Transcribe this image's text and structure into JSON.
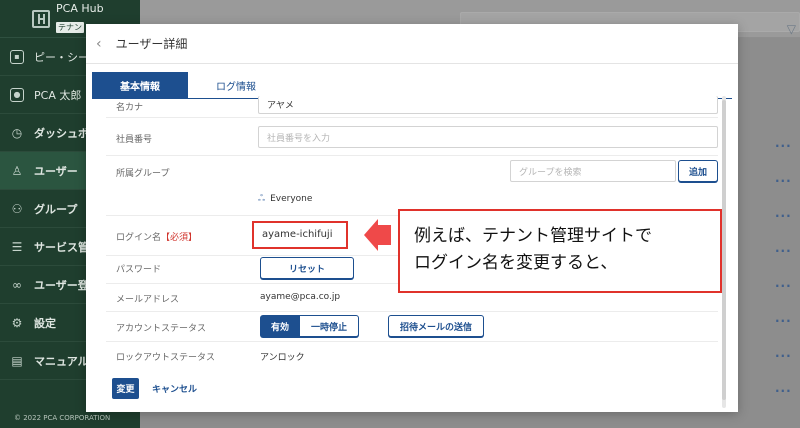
{
  "sidebar": {
    "logo_text": "PCA Hub",
    "logo_sub": "テナン",
    "items": [
      {
        "label": "ピー・シー",
        "icon": "building-icon"
      },
      {
        "label": "PCA 太郎",
        "icon": "user-avatar-icon"
      },
      {
        "label": "ダッシュボ",
        "icon": "clock-icon"
      },
      {
        "label": "ユーザー",
        "icon": "person-icon"
      },
      {
        "label": "グループ",
        "icon": "group-icon"
      },
      {
        "label": "サービス管",
        "icon": "server-icon"
      },
      {
        "label": "ユーザー登",
        "icon": "link-icon"
      },
      {
        "label": "設定",
        "icon": "gear-icon"
      },
      {
        "label": "マニュアル",
        "icon": "book-icon"
      }
    ],
    "copyright": "© 2022 PCA CORPORATION"
  },
  "modal": {
    "title": "ユーザー詳細",
    "tabs": [
      "基本情報",
      "ログ情報"
    ]
  },
  "form": {
    "kana_label": "名カナ",
    "kana_value": "アヤメ",
    "employee_label": "社員番号",
    "employee_placeholder": "社員番号を入力",
    "group_label": "所属グループ",
    "group_search_placeholder": "グループを検索",
    "group_add_button": "追加",
    "group_member": "Everyone",
    "login_label": "ログイン名",
    "login_required": "【必須】",
    "login_value": "ayame-ichifuji",
    "password_label": "パスワード",
    "password_reset_button": "リセット",
    "email_label": "メールアドレス",
    "email_value": "ayame@pca.co.jp",
    "account_status_label": "アカウントステータス",
    "status_enabled": "有効",
    "status_suspended": "一時停止",
    "invite_button": "招待メールの送信",
    "lockout_label": "ロックアウトステータス",
    "lockout_value": "アンロック"
  },
  "footer": {
    "save_button": "変更",
    "cancel_button": "キャンセル"
  },
  "callout": {
    "line1": "例えば、テナント管理サイトで",
    "line2": "ログイン名を変更すると、"
  },
  "row_menu_glyph": "···"
}
